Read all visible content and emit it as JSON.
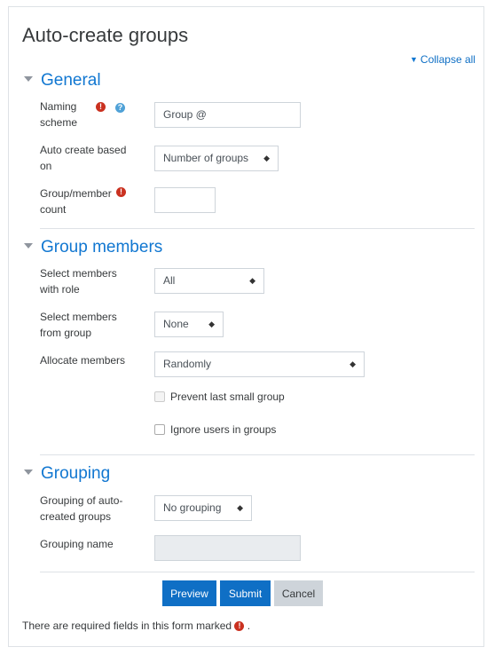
{
  "title": "Auto-create groups",
  "collapse_all": "Collapse all",
  "sections": {
    "general": "General",
    "members": "Group members",
    "grouping": "Grouping"
  },
  "fields": {
    "naming_scheme": {
      "label1": "Naming",
      "label2": "scheme",
      "value": "Group @"
    },
    "auto_create": {
      "label1": "Auto create based",
      "label2": "on",
      "selected": "Number of groups"
    },
    "count": {
      "label1": "Group/member",
      "label2": "count",
      "value": ""
    },
    "role": {
      "label1": "Select members",
      "label2": "with role",
      "selected": "All"
    },
    "from_group": {
      "label1": "Select members",
      "label2": "from group",
      "selected": "None"
    },
    "allocate": {
      "label": "Allocate members",
      "selected": "Randomly"
    },
    "prevent_small": {
      "label": "Prevent last small group",
      "checked": false,
      "disabled": true
    },
    "ignore_users": {
      "label": "Ignore users in groups",
      "checked": false
    },
    "grouping_of": {
      "label1": "Grouping of auto-",
      "label2": "created groups",
      "selected": "No grouping"
    },
    "grouping_name": {
      "label": "Grouping name",
      "value": ""
    }
  },
  "buttons": {
    "preview": "Preview",
    "submit": "Submit",
    "cancel": "Cancel"
  },
  "footnote": {
    "text": "There are required fields in this form marked",
    "period": "."
  },
  "icons": {
    "required": "exclamation-circle-icon",
    "help": "question-circle-icon",
    "select_arrow": "updown-arrow-icon"
  },
  "colors": {
    "link": "#1177d1",
    "primary": "#0f6fc5",
    "required": "#ca3120",
    "help": "#4fa1d7"
  }
}
